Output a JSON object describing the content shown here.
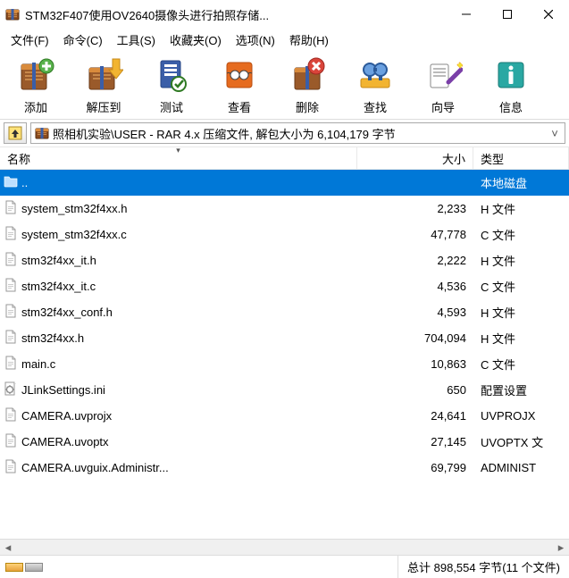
{
  "window": {
    "title": "STM32F407使用OV2640摄像头进行拍照存储..."
  },
  "menu": {
    "file": "文件(F)",
    "command": "命令(C)",
    "tools": "工具(S)",
    "favorites": "收藏夹(O)",
    "options": "选项(N)",
    "help": "帮助(H)"
  },
  "toolbar": {
    "add": "添加",
    "extract_to": "解压到",
    "test": "测试",
    "view": "查看",
    "delete": "删除",
    "find": "查找",
    "wizard": "向导",
    "info": "信息"
  },
  "addressbar": {
    "path": "照相机实验\\USER - RAR 4.x 压缩文件, 解包大小为 6,104,179 字节"
  },
  "columns": {
    "name": "名称",
    "size": "大小",
    "type": "类型"
  },
  "files": [
    {
      "name": "..",
      "size": "",
      "type": "本地磁盘",
      "icon": "folder",
      "selected": true
    },
    {
      "name": "system_stm32f4xx.h",
      "size": "2,233",
      "type": "H 文件",
      "icon": "file"
    },
    {
      "name": "system_stm32f4xx.c",
      "size": "47,778",
      "type": "C 文件",
      "icon": "file"
    },
    {
      "name": "stm32f4xx_it.h",
      "size": "2,222",
      "type": "H 文件",
      "icon": "file"
    },
    {
      "name": "stm32f4xx_it.c",
      "size": "4,536",
      "type": "C 文件",
      "icon": "file"
    },
    {
      "name": "stm32f4xx_conf.h",
      "size": "4,593",
      "type": "H 文件",
      "icon": "file"
    },
    {
      "name": "stm32f4xx.h",
      "size": "704,094",
      "type": "H 文件",
      "icon": "file"
    },
    {
      "name": "main.c",
      "size": "10,863",
      "type": "C 文件",
      "icon": "file"
    },
    {
      "name": "JLinkSettings.ini",
      "size": "650",
      "type": "配置设置",
      "icon": "ini"
    },
    {
      "name": "CAMERA.uvprojx",
      "size": "24,641",
      "type": "UVPROJX",
      "icon": "file"
    },
    {
      "name": "CAMERA.uvoptx",
      "size": "27,145",
      "type": "UVOPTX 文",
      "icon": "file"
    },
    {
      "name": "CAMERA.uvguix.Administr...",
      "size": "69,799",
      "type": "ADMINIST",
      "icon": "file"
    }
  ],
  "statusbar": {
    "summary": "总计 898,554 字节(11 个文件)"
  }
}
